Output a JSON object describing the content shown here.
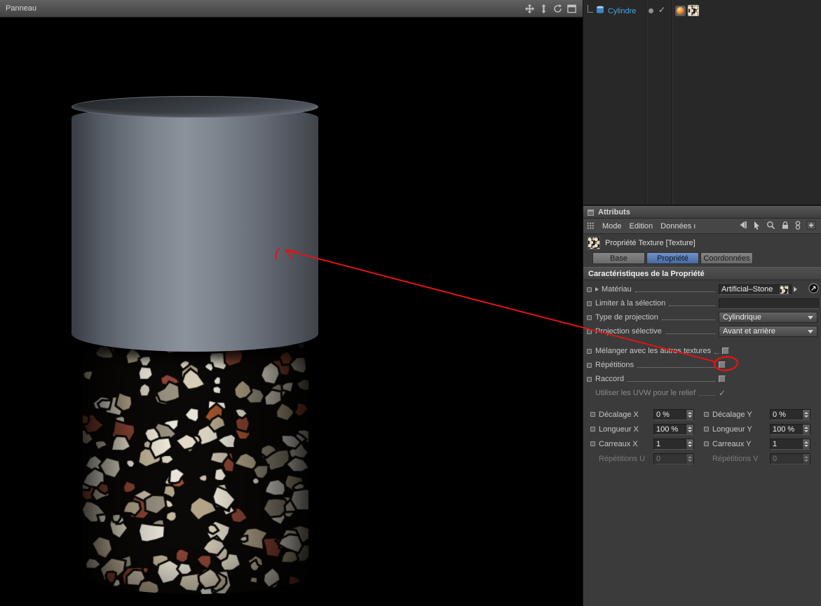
{
  "colors": {
    "accent_tab_blue": "#4e74ae",
    "annotation_red": "#dd1515",
    "object_name_blue": "#4aa2e2",
    "panel_bg": "#3b3b3b",
    "viewport_bg": "#000000"
  },
  "viewport": {
    "title": "Panneau"
  },
  "object_manager": {
    "object_name": "Cylindre"
  },
  "attributes": {
    "panel_title": "Attributs",
    "menu": [
      "Mode",
      "Edition",
      "Données ı"
    ],
    "property_title": "Propriété Texture [Texture]",
    "tabs": [
      {
        "label": "Base",
        "active": false
      },
      {
        "label": "Propriété",
        "active": true
      },
      {
        "label": "Coordonnées",
        "active": false
      }
    ],
    "section_title": "Caractéristiques de la Propriété",
    "material": {
      "label": "Matériau",
      "value": "Artificial–Stone"
    },
    "restrict": {
      "label": "Limiter à la sélection",
      "value": ""
    },
    "projection": {
      "label": "Type de projection",
      "value": "Cylindrique"
    },
    "selective": {
      "label": "Projection sélective",
      "value": "Avant et arrière"
    },
    "toggles": [
      {
        "label": "Mélanger avec les autres textures",
        "checked": false
      },
      {
        "label": "Répétitions",
        "checked": false,
        "highlighted": true
      },
      {
        "label": "Raccord",
        "checked": false
      },
      {
        "label": "Utiliser les UVW pour le relief",
        "checked": true,
        "disabled": true
      }
    ],
    "numeric_rows": [
      {
        "left_label": "Décalage X",
        "left_value": "0 %",
        "right_label": "Décalage Y",
        "right_value": "0 %",
        "disabled": false
      },
      {
        "left_label": "Longueur X",
        "left_value": "100 %",
        "right_label": "Longueur Y",
        "right_value": "100 %",
        "disabled": false
      },
      {
        "left_label": "Carreaux X",
        "left_value": "1",
        "right_label": "Carreaux Y",
        "right_value": "1",
        "disabled": false
      },
      {
        "left_label": "Répétitions U",
        "left_value": "0",
        "right_label": "Répétitions V",
        "right_value": "0",
        "disabled": true
      }
    ]
  },
  "icons": {
    "move": "cross-arrows",
    "updown": "vertical-arrows",
    "rotate": "circular-arrow",
    "maximize": "window-frame",
    "back": "left-triangle-bar",
    "cursor": "pointer-arrow",
    "search": "magnifier",
    "lock": "padlock",
    "link": "double-ring",
    "add": "plus-box",
    "grip": "dot-grid",
    "window": "window",
    "cylinder": "blue-cylinder",
    "material_tag": "orange-sphere",
    "texture_tag": "stone-thumbnail",
    "pick": "circle-arrow",
    "expander": "right-triangle"
  }
}
